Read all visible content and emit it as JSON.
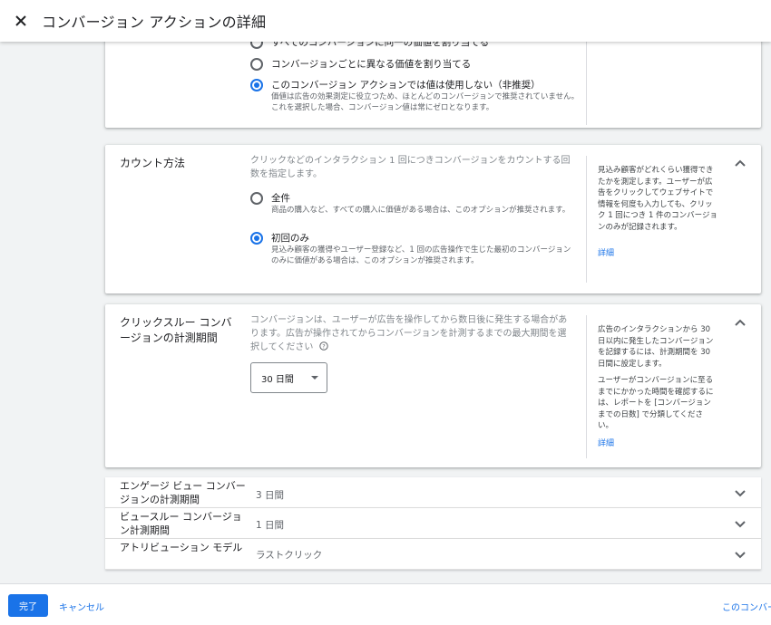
{
  "header": {
    "title": "コンバージョン アクションの詳細",
    "close_icon": "close-icon"
  },
  "value_section": {
    "options": [
      {
        "label": "すべてのコンバージョンに同一の価値を割り当てる",
        "selected": false
      },
      {
        "label": "コンバージョンごとに異なる価値を割り当てる",
        "selected": false
      },
      {
        "label": "このコンバージョン アクションでは値は使用しない（非推奨）",
        "selected": true,
        "sub": "価値は広告の効果測定に役立つため、ほとんどのコンバージョンで推奨されていません。これを選択した場合、コンバージョン値は常にゼロとなります。"
      }
    ]
  },
  "count_section": {
    "title": "カウント方法",
    "description": "クリックなどのインタラクション 1 回につきコンバージョンをカウントする回数を指定します。",
    "options": [
      {
        "label": "全件",
        "selected": false,
        "sub": "商品の購入など、すべての購入に価値がある場合は、このオプションが推奨されます。"
      },
      {
        "label": "初回のみ",
        "selected": true,
        "sub": "見込み顧客の獲得やユーザー登録など、1 回の広告操作で生じた最初のコンバージョンのみに価値がある場合は、このオプションが推奨されます。"
      }
    ],
    "help": "見込み顧客がどれくらい獲得できたかを測定します。ユーザーが広告をクリックしてウェブサイトで情報を何度も入力しても、クリック 1 回につき 1 件のコンバージョンのみが記録されます。",
    "help_link": "詳細"
  },
  "click_through_section": {
    "title": "クリックスルー コンバージョンの計測期間",
    "description": "コンバージョンは、ユーザーが広告を操作してから数日後に発生する場合があります。広告が操作されてからコンバージョンを計測するまでの最大期間を選択してください",
    "help_icon": "help-circle-icon",
    "select_value": "30 日間",
    "help_p1": "広告のインタラクションから 30 日以内に発生したコンバージョンを記録するには、計測期間を 30 日間に設定します。",
    "help_p2": "ユーザーがコンバージョンに至るまでにかかった時間を確認するには、レポートを [コンバージョンまでの日数] で分類してください。",
    "help_link": "詳細"
  },
  "collapsed_rows": [
    {
      "title": "エンゲージ ビュー コンバージョンの計測期間",
      "value": "3 日間"
    },
    {
      "title": "ビュースルー コンバージョン計測期間",
      "value": "1 日間"
    },
    {
      "title": "アトリビューション モデル",
      "value": "ラストクリック"
    }
  ],
  "footer": {
    "done_label": "完了",
    "cancel_label": "キャンセル",
    "right_link": "このコンバー"
  }
}
